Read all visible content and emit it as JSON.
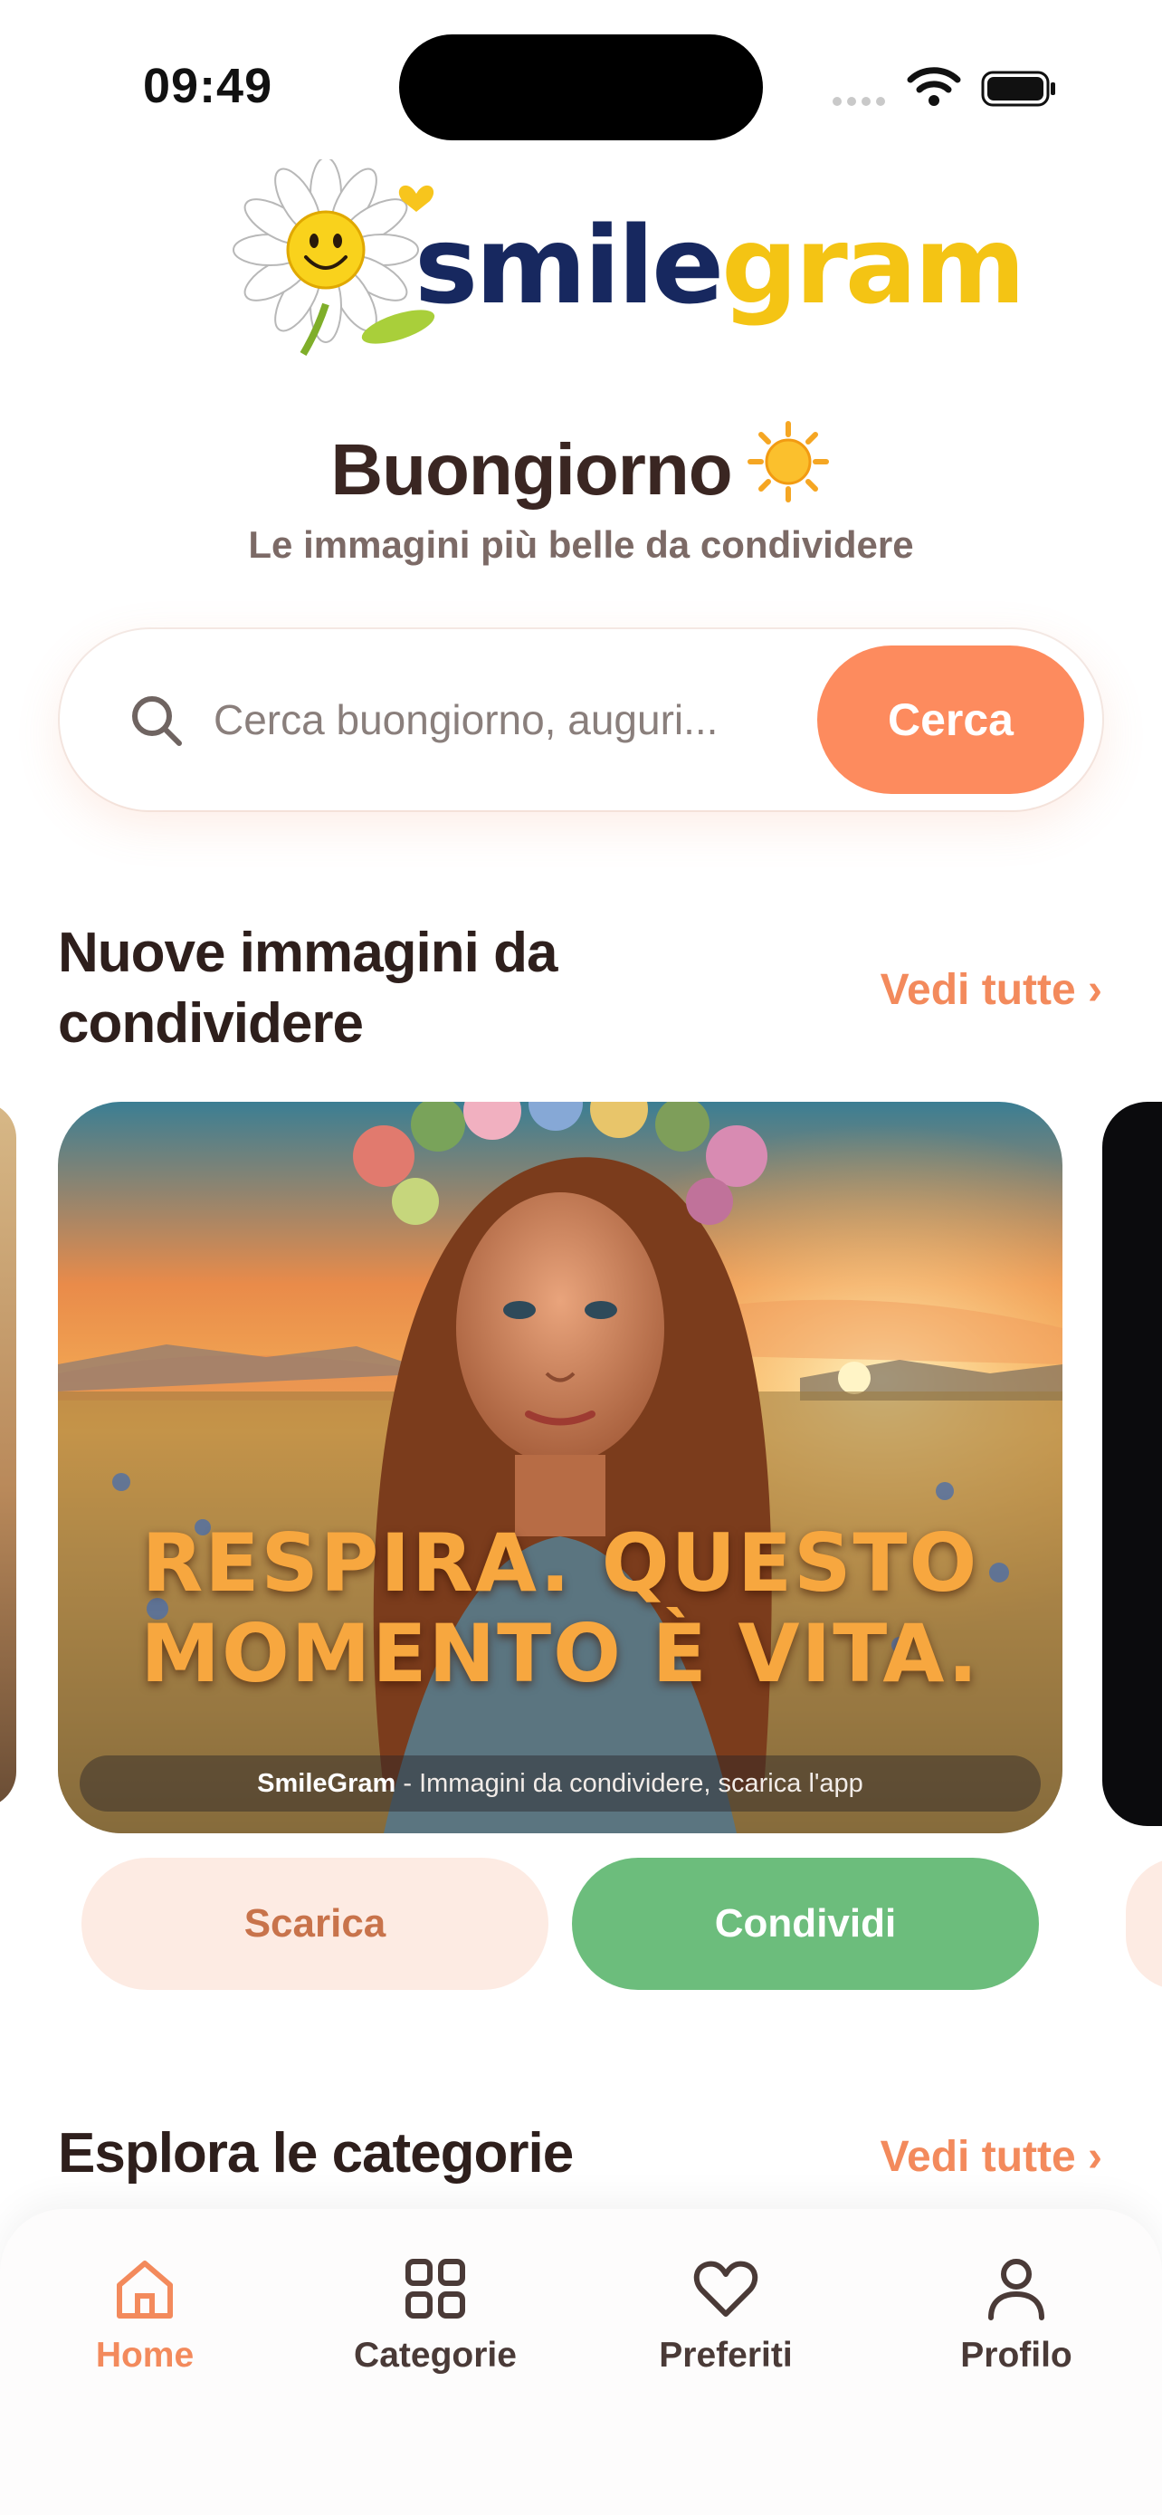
{
  "status_bar": {
    "time": "09:49"
  },
  "logo": {
    "word_part1": "smile",
    "word_part2": "gram"
  },
  "header": {
    "greeting": "Buongiorno",
    "subtitle": "Le immagini più belle da condividere"
  },
  "search": {
    "placeholder": "Cerca buongiorno, auguri...",
    "button_label": "Cerca"
  },
  "new_images": {
    "title_line1": "Nuove immagini da",
    "title_line2": "condividere",
    "see_all": "Vedi tutte ›",
    "card": {
      "quote_line1": "RESPIRA. QUESTO",
      "quote_line2": "MOMENTO È VITA.",
      "watermark_brand": "SmileGram",
      "watermark_text": " - Immagini da condividere, scarica l'app"
    },
    "download_label": "Scarica",
    "share_label": "Condividi"
  },
  "categories": {
    "title": "Esplora le categorie",
    "see_all": "Vedi tutte ›"
  },
  "tabbar": {
    "accent": "#f38a5c",
    "items": [
      {
        "label": "Home",
        "icon": "home-icon",
        "active": true
      },
      {
        "label": "Categorie",
        "icon": "grid-icon",
        "active": false
      },
      {
        "label": "Preferiti",
        "icon": "heart-icon",
        "active": false
      },
      {
        "label": "Profilo",
        "icon": "user-icon",
        "active": false
      }
    ]
  },
  "colors": {
    "primary_orange": "#fd8b5e",
    "share_green": "#6cbd7c",
    "download_bg": "#fdebe3"
  }
}
